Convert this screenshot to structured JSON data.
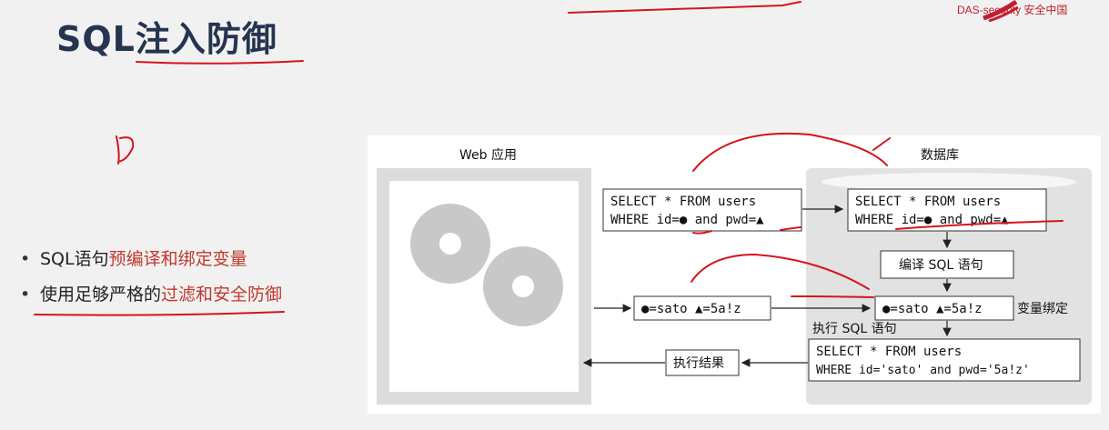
{
  "title": "SQL注入防御",
  "logo": {
    "text": "DAS-security 安全中国"
  },
  "bullets": [
    {
      "prefix": "SQL语句",
      "highlight": "预编译和绑定变量",
      "suffix": ""
    },
    {
      "prefix": "使用足够严格的",
      "highlight": "过滤和安全防御",
      "suffix": ""
    }
  ],
  "diagram": {
    "web_label": "Web 应用",
    "db_label": "数据库",
    "query1_line1": "SELECT * FROM users",
    "query1_line2": "WHERE id=● and pwd=▲",
    "query2_line1": "SELECT * FROM users",
    "query2_line2": "WHERE id=● and pwd=▲",
    "compile_label": "编译 SQL 语句",
    "bind_values_left": "●=sato ▲=5a!z",
    "bind_values_right": "●=sato ▲=5a!z",
    "bind_label": "变量绑定",
    "exec_label": "执行 SQL 语句",
    "final_line1": "SELECT * FROM users",
    "final_line2": "WHERE id='sato' and pwd='5a!z'",
    "result_label": "执行结果"
  }
}
